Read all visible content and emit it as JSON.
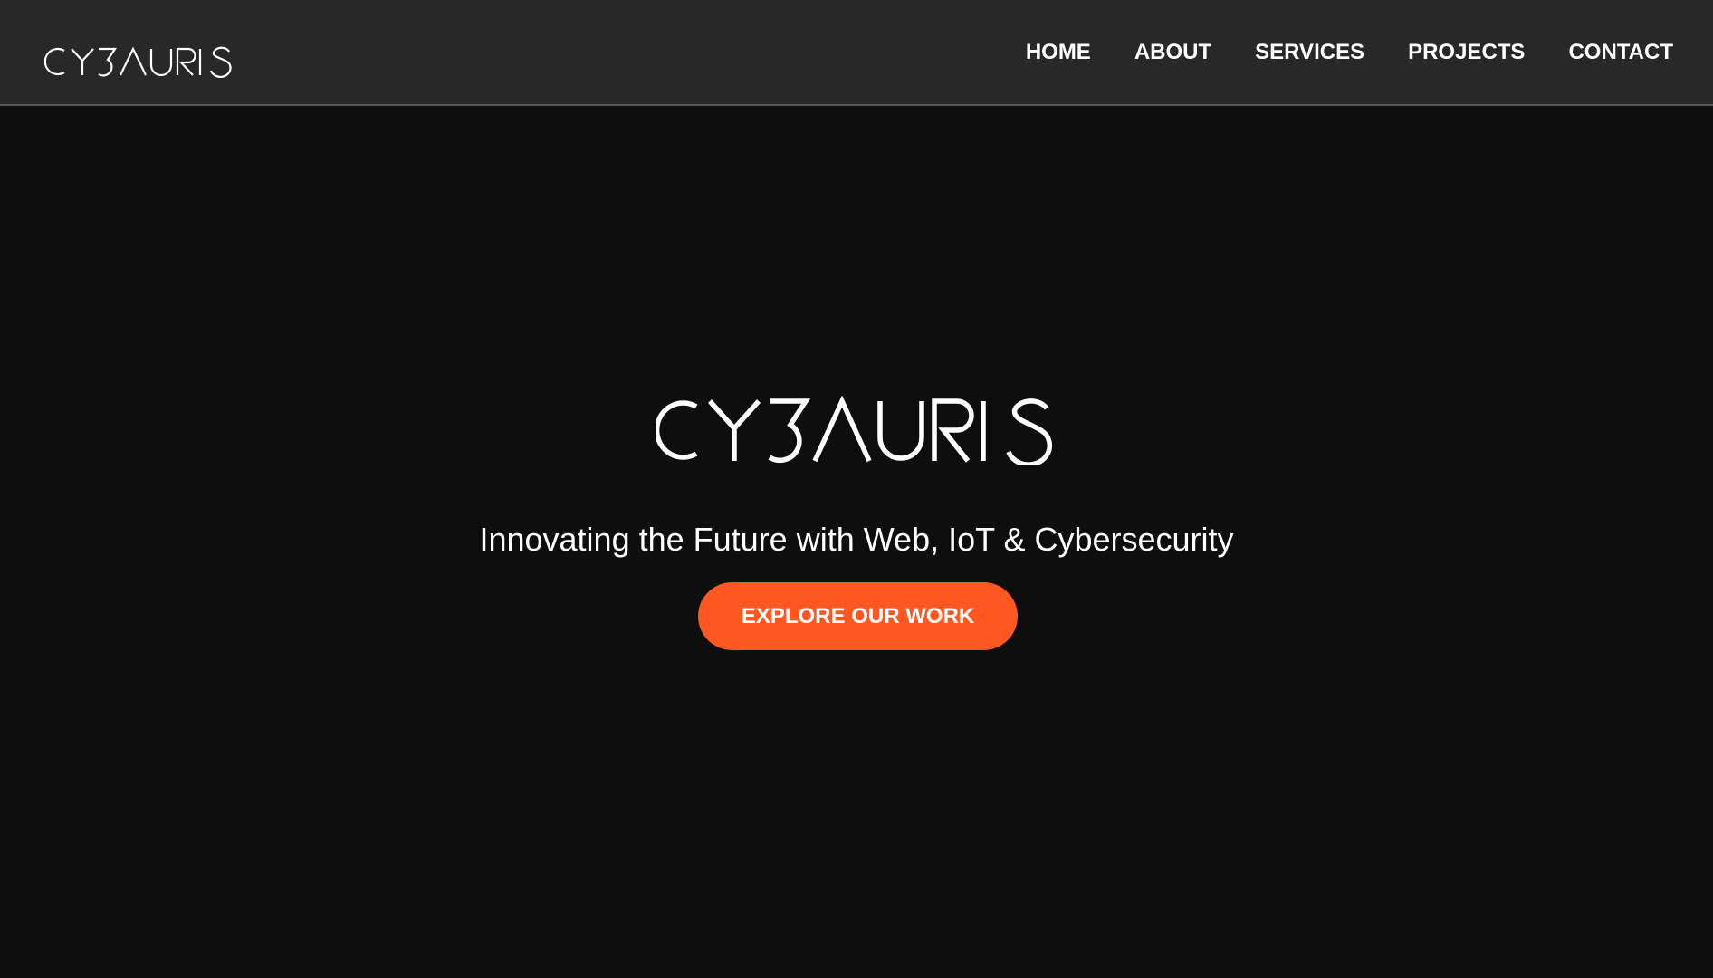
{
  "brand": {
    "name": "CYBAURIS",
    "logo_color": "#ffffff"
  },
  "nav": {
    "items": [
      {
        "label": "HOME"
      },
      {
        "label": "ABOUT"
      },
      {
        "label": "SERVICES"
      },
      {
        "label": "PROJECTS"
      },
      {
        "label": "CONTACT"
      }
    ]
  },
  "hero": {
    "tagline": "Innovating the Future with Web, IoT & Cybersecurity",
    "cta_label": "EXPLORE OUR WORK"
  },
  "colors": {
    "header_bg": "#282828",
    "page_bg": "#0e0e0e",
    "accent": "#ff5722",
    "text": "#ffffff"
  }
}
